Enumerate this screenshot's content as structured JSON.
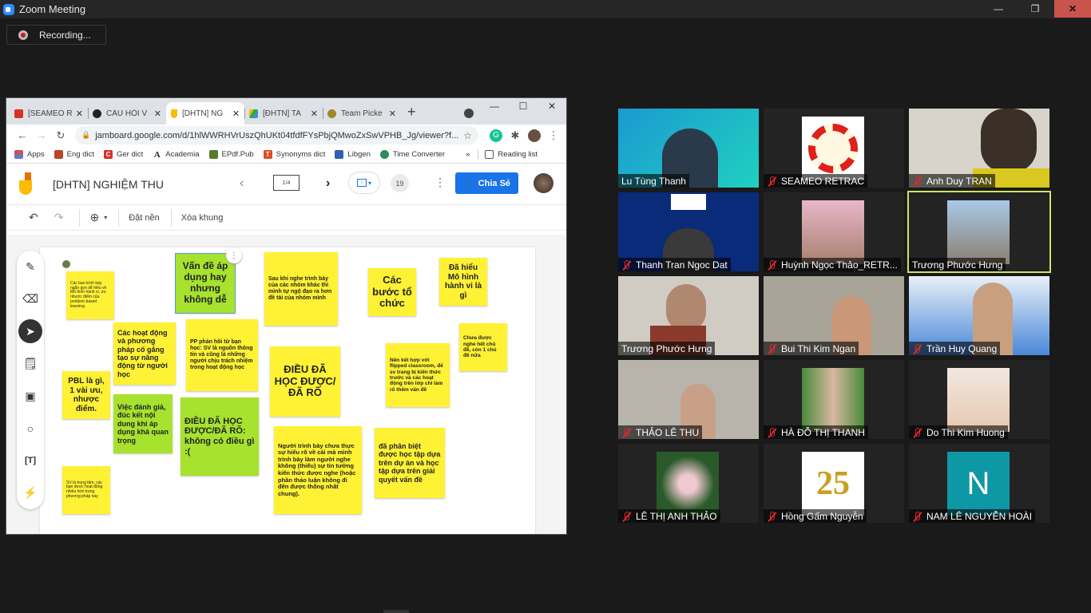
{
  "zoom": {
    "window_title": "Zoom Meeting",
    "recording_label": "Recording...",
    "window_controls": {
      "minimize": "—",
      "restore": "❐",
      "close": "✕"
    },
    "colors": {
      "close_bg": "#c8544b",
      "active_speaker": "#cde26a",
      "mute_red": "#e02828"
    }
  },
  "browser": {
    "tabs": [
      {
        "label": "[SEAMEO R",
        "favicon": "gmail-icon",
        "color": "#d93025",
        "active": false
      },
      {
        "label": "CÂU HỎI V",
        "favicon": "avatar-icon",
        "color": "#222",
        "active": false
      },
      {
        "label": "[DHTN] NG",
        "favicon": "jamboard-icon",
        "color": "#fbbc04",
        "active": true
      },
      {
        "label": "[ĐHTN] TA",
        "favicon": "drive-icon",
        "color": "#34a853",
        "active": false
      },
      {
        "label": "Team Picke",
        "favicon": "picker-icon",
        "color": "#9c8a2a",
        "active": false
      }
    ],
    "new_tab": "+",
    "url": "jamboard.google.com/d/1hlWWRHVrUszQhUKt04tfdfFYsPbjQMwoZxSwVPHB_Jg/viewer?f...",
    "bookmarks": [
      {
        "label": "Apps",
        "icon": "apps-grid-icon",
        "color": "#ea4335"
      },
      {
        "label": "Eng dict",
        "icon": "cambridge-icon",
        "color": "#b8442a"
      },
      {
        "label": "Ger dict",
        "icon": "ger-dict-icon",
        "color": "#d93025"
      },
      {
        "label": "Academia",
        "icon": "academia-icon",
        "color": "#222"
      },
      {
        "label": "EPdf.Pub",
        "icon": "epdf-icon",
        "color": "#5a7a2a"
      },
      {
        "label": "Synonyms dict",
        "icon": "synonyms-icon",
        "color": "#e04a24"
      },
      {
        "label": "Libgen",
        "icon": "libgen-icon",
        "color": "#3060b0"
      },
      {
        "label": "Time Converter",
        "icon": "time-converter-icon",
        "color": "#2a8a5a"
      }
    ],
    "more_bookmarks": "»",
    "reading_list": "Reading list"
  },
  "jamboard": {
    "title": "[DHTN] NGHIỆM THU",
    "frame_indicator": "1/4",
    "viewer_count": "19",
    "share_label": "Chia Sẻ",
    "toolbar": {
      "set_background": "Đặt nền",
      "clear_frame": "Xóa khung"
    },
    "notes": [
      {
        "text": "Các bạn trình bày ngắn gọn dễ hiểu về Mô hình hành vi, ưu nhược điểm của problem based learning.",
        "color": "yellow"
      },
      {
        "text": "Vấn đề áp dụng hay nhưng không dễ",
        "color": "green"
      },
      {
        "text": "Sau khi nghe trình bày của các nhóm khác thì mình tự ngộ đạo ra hơn đề tài của nhóm mình",
        "color": "yellow"
      },
      {
        "text": "Các bước tổ chức",
        "color": "yellow"
      },
      {
        "text": "Đã hiểu Mô hình hành vi là gì",
        "color": "yellow"
      },
      {
        "text": "Các hoạt động và phương pháp cố gắng tạo sự năng động từ người học",
        "color": "yellow"
      },
      {
        "text": "PP phản hồi từ bạn học: SV là nguồn thông tin và cũng là những người chịu trách nhiệm trong hoạt động học",
        "color": "yellow"
      },
      {
        "text": "ĐIỀU ĐÃ HỌC ĐƯỢC/ĐÃ RÕ",
        "color": "yellow"
      },
      {
        "text": "Nên kết hợp với flipped classroom, để sv trang bị kiến thức trước và các hoạt động trên lớp chỉ làm rõ thêm vấn đề",
        "color": "yellow"
      },
      {
        "text": "Chưa được nghe hết chủ đề, còn 1 chủ đề nữa",
        "color": "yellow"
      },
      {
        "text": "PBL là gì, 1 vài ưu, nhược điểm.",
        "color": "yellow"
      },
      {
        "text": "Việc đánh giá, đúc kết nội dung khi áp dụng khá quan trọng",
        "color": "green"
      },
      {
        "text": "ĐIỀU ĐÃ HỌC ĐƯỢC/ĐÃ RÕ: không có điều gì :(",
        "color": "green"
      },
      {
        "text": "Người trình bày chưa thực sự hiểu rõ về cái mà mình trình bày làm người nghe không (thiếu) sự tin tưởng kiến thức được nghe (hoặc phần thảo luận không đi đến được thống nhất chung).",
        "color": "yellow"
      },
      {
        "text": "đã phân biệt được học tập dựa trên dự án và học tập dựa trên  giải quyết vấn đề",
        "color": "yellow"
      },
      {
        "text": "SV là trung tâm, các bạn được hoạt động nhiều hơn trong phương pháp này",
        "color": "yellow"
      }
    ],
    "side_tools": [
      "pen-icon",
      "eraser-icon",
      "select-icon",
      "sticky-note-icon",
      "image-icon",
      "circle-icon",
      "text-box-icon",
      "laser-icon"
    ],
    "colors": {
      "note_yellow": "#fff234",
      "note_green": "#a6e22e",
      "share_blue": "#1a73e8"
    }
  },
  "participants": [
    {
      "name": "Lu Tùng Thanh",
      "muted": false,
      "bg": "#1aa0c8"
    },
    {
      "name": "SEAMEO RETRAC",
      "muted": true,
      "bg": "#232323"
    },
    {
      "name": "Anh Duy TRAN",
      "muted": true,
      "bg": "#d8d4cc"
    },
    {
      "name": "Thanh Tran Ngoc Dat",
      "muted": true,
      "bg": "#0a2a7a"
    },
    {
      "name": "Huỳnh Ngọc Thảo_RETR...",
      "muted": true,
      "bg": "#232323"
    },
    {
      "name": "Trương Phước Hưng",
      "muted": false,
      "bg": "#232323",
      "active_speaker": true
    },
    {
      "name": "Trương Phước Hưng",
      "muted": false,
      "bg": "#c8c4bc"
    },
    {
      "name": "Bui Thi Kim Ngan",
      "muted": true,
      "bg": "#a8a498"
    },
    {
      "name": "Trần Huy Quang",
      "muted": true,
      "bg": "#4a88d8"
    },
    {
      "name": "THẢO LÊ THU",
      "muted": true,
      "bg": "#b8b4ac"
    },
    {
      "name": "HÀ ĐỖ THỊ THANH",
      "muted": true,
      "bg": "#232323"
    },
    {
      "name": "Do Thi Kim Huong",
      "muted": true,
      "bg": "#232323"
    },
    {
      "name": "LÊ THỊ ANH THẢO",
      "muted": true,
      "bg": "#232323"
    },
    {
      "name": "Hồng Gấm Nguyễn",
      "muted": true,
      "bg": "#232323"
    },
    {
      "name": "NAM LÊ NGUYỄN HOÀI",
      "muted": true,
      "bg": "#232323",
      "initial": "N"
    }
  ]
}
